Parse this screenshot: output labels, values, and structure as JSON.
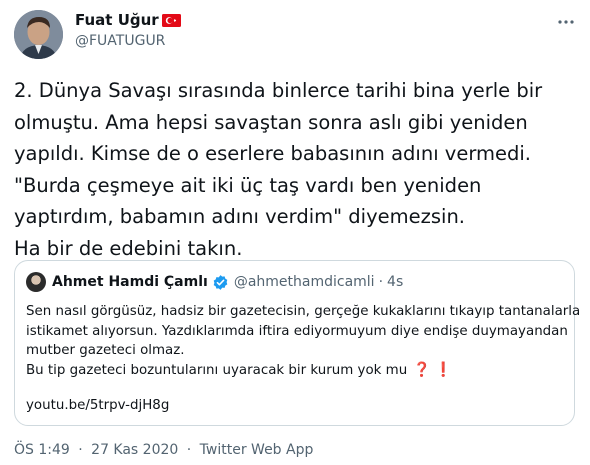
{
  "author": {
    "display_name": "Fuat Uğur",
    "flag_icon": "turkey-flag-icon",
    "handle": "@FUATUGUR"
  },
  "tweet": {
    "text": "2. Dünya Savaşı sırasında binlerce tarihi bina yerle bir\nolmuştu. Ama hepsi savaştan sonra aslı gibi yeniden\nyapıldı. Kimse de o eserlere babasının adını vermedi.\n\"Burda çeşmeye ait iki üç taş vardı ben yeniden\nyaptırdım, babamın adını verdim\" diyemezsin.\nHa bir de edebini takın."
  },
  "quote": {
    "name": "Ahmet Hamdi Çamlı",
    "verified_icon": "verified-badge-icon",
    "handle": "@ahmethamdicamli",
    "separator": "·",
    "time": "4s",
    "lines": [
      "Sen nasıl görgüsüz, hadsiz bir gazetecisin, gerçeğe kukaklarını tıkayıp tantanalarla",
      "istikamet alıyorsun. Yazdıklarımda iftira ediyormuyum diye endişe duymayandan",
      "mutber gazeteci olmaz.",
      "Bu tip gazeteci bozuntularını uyaracak bir kurum yok mu"
    ],
    "emoji_question": "❓",
    "emoji_exclamation": "❗",
    "link": "youtu.be/5trpv-djH8g"
  },
  "meta": {
    "time": "ÖS 1:49",
    "separator": "·",
    "date": "27 Kas 2020",
    "source": "Twitter Web App"
  },
  "colors": {
    "text": "#0f1419",
    "secondary": "#536471",
    "border": "#cfd9de",
    "verified": "#1d9bf0",
    "flag_red": "#e30a17"
  }
}
